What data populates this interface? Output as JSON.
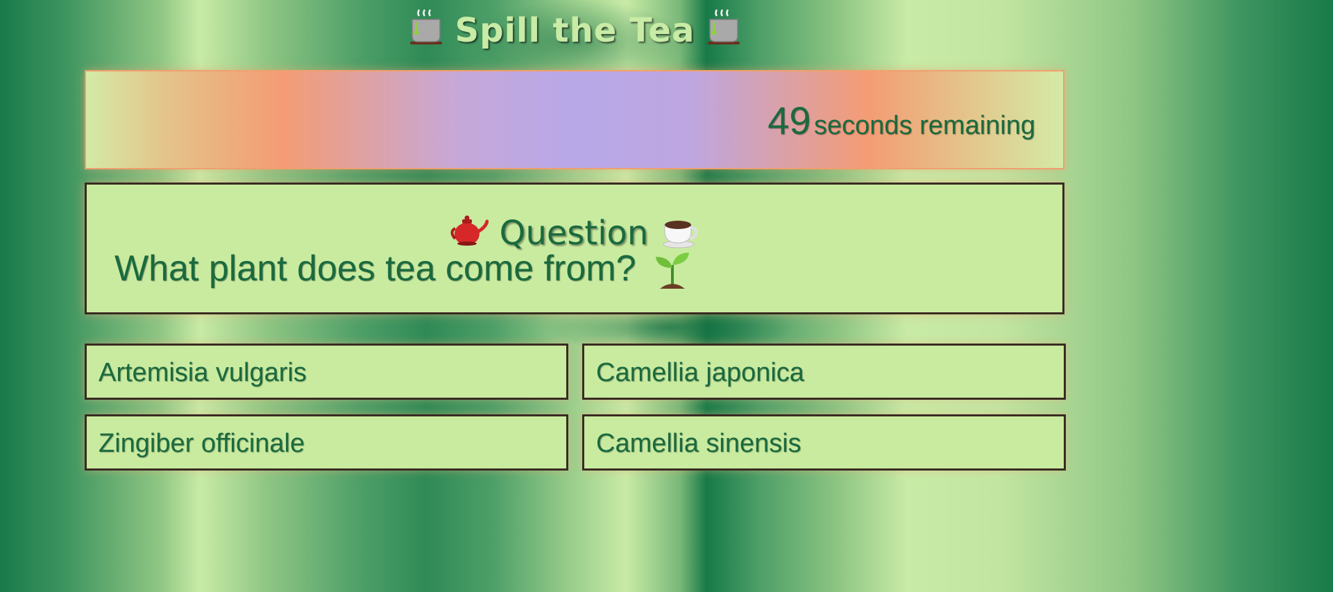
{
  "header": {
    "title": "Spill the Tea",
    "left_icon": "tea-cup-icon",
    "right_icon": "tea-cup-icon"
  },
  "timer": {
    "seconds": "49",
    "label": "seconds remaining"
  },
  "question": {
    "heading": "Question",
    "heading_left_icon": "teapot-icon",
    "heading_right_icon": "coffee-cup-icon",
    "text": "What plant does tea come from?",
    "text_icon": "seedling-icon"
  },
  "answers": [
    {
      "label": "Artemisia vulgaris"
    },
    {
      "label": "Camellia japonica"
    },
    {
      "label": "Zingiber officinale"
    },
    {
      "label": "Camellia sinensis"
    }
  ],
  "colors": {
    "text_green": "#1a6a3e",
    "panel_green": "#c9eba0",
    "border_dark": "#3a2a22",
    "timer_border": "#f0a070"
  }
}
